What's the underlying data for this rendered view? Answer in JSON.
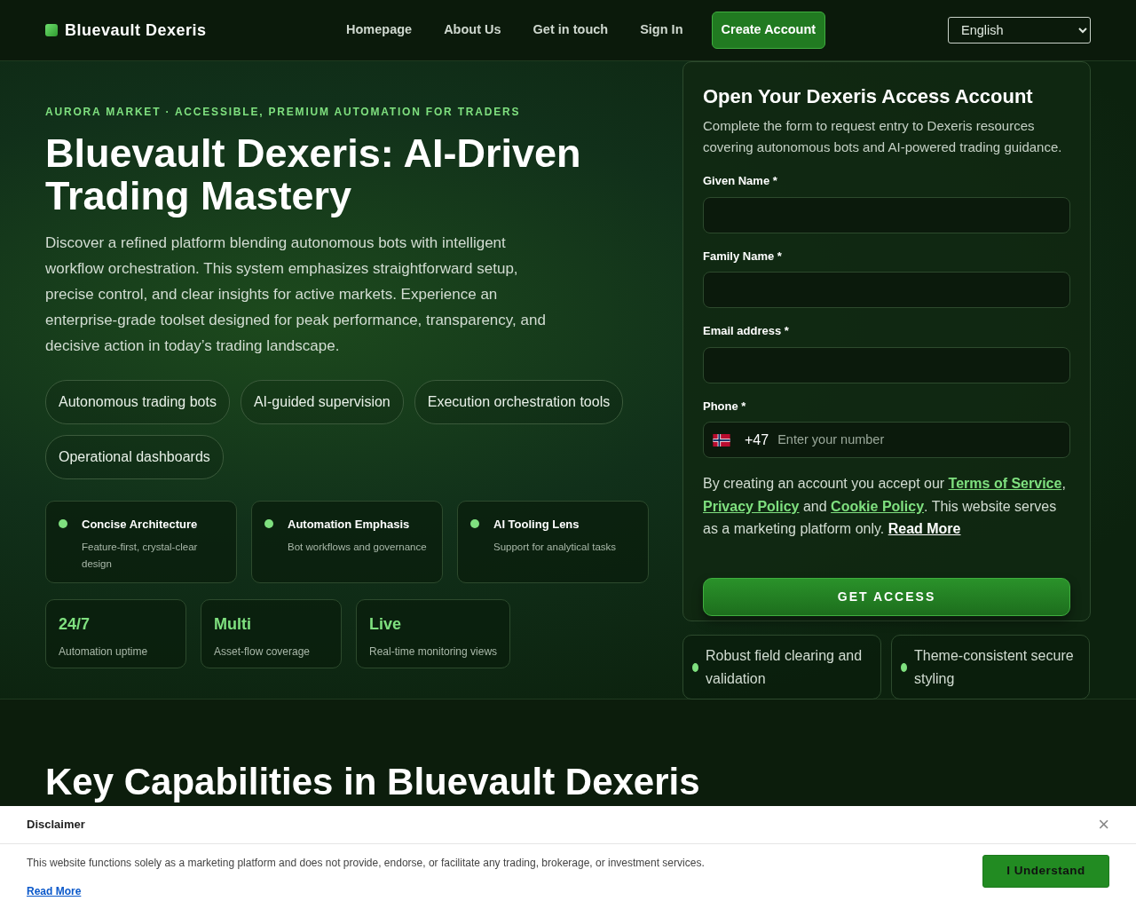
{
  "brand": "Bluevault Dexeris",
  "nav": [
    {
      "label": "Homepage",
      "kind": "link"
    },
    {
      "label": "About Us",
      "kind": "link"
    },
    {
      "label": "Get in touch",
      "kind": "link"
    },
    {
      "label": "Sign In",
      "kind": "link"
    },
    {
      "label": "Create Account",
      "kind": "cta"
    }
  ],
  "language": "English",
  "hero": {
    "eyebrow": "AURORA MARKET · ACCESSIBLE, PREMIUM AUTOMATION FOR TRADERS",
    "title": "Bluevault Dexeris: AI-Driven Trading Mastery",
    "lead": "Discover a refined platform blending autonomous bots with intelligent workflow orchestration. This system emphasizes straightforward setup, precise control, and clear insights for active markets. Experience an enterprise-grade toolset designed for peak performance, transparency, and decisive action in today’s trading landscape.",
    "pills": [
      "Autonomous trading bots",
      "AI-guided supervision",
      "Execution orchestration tools",
      "Operational dashboards"
    ],
    "features": [
      {
        "title": "Concise Architecture",
        "text": "Feature-first, crystal-clear design"
      },
      {
        "title": "Automation Emphasis",
        "text": "Bot workflows and governance"
      },
      {
        "title": "AI Tooling Lens",
        "text": "Support for analytical tasks"
      }
    ],
    "stats": [
      {
        "value": "24/7",
        "label": "Automation uptime"
      },
      {
        "value": "Multi",
        "label": "Asset-flow coverage"
      },
      {
        "value": "Live",
        "label": "Real-time monitoring views"
      }
    ]
  },
  "form": {
    "title": "Open Your Dexeris Access Account",
    "intro": "Complete the form to request entry to Dexeris resources covering autonomous bots and AI-powered trading guidance.",
    "fields": [
      {
        "label": "Given Name",
        "required": "*",
        "kind": "text"
      },
      {
        "label": "Family Name",
        "required": "*",
        "kind": "text"
      },
      {
        "label": "Email address",
        "required": "*",
        "kind": "text"
      },
      {
        "label": "Phone",
        "required": "*",
        "kind": "phone",
        "code": "+47",
        "placeholder": "Enter your number"
      }
    ],
    "consent": [
      {
        "kind": "text",
        "text": "By creating an account you accept our "
      },
      {
        "kind": "link",
        "text": "Terms of Service"
      },
      {
        "kind": "text",
        "text": ", "
      },
      {
        "kind": "link",
        "text": "Privacy Policy"
      },
      {
        "kind": "text",
        "text": " and "
      },
      {
        "kind": "link",
        "text": "Cookie Policy"
      },
      {
        "kind": "text",
        "text": ". This website serves as a marketing platform only. "
      },
      {
        "kind": "more",
        "text": "Read More"
      }
    ],
    "submit": "GET ACCESS"
  },
  "notes": [
    "Robust field clearing and validation",
    "Theme-consistent secure styling"
  ],
  "section_title": "Key Capabilities in Bluevault Dexeris",
  "disclaimer": {
    "title": "Disclaimer",
    "close": "×",
    "text": "This website functions solely as a marketing platform and does not provide, endorse, or facilitate any trading, brokerage, or investment services.",
    "link": "Read More",
    "button": "I Understand"
  }
}
